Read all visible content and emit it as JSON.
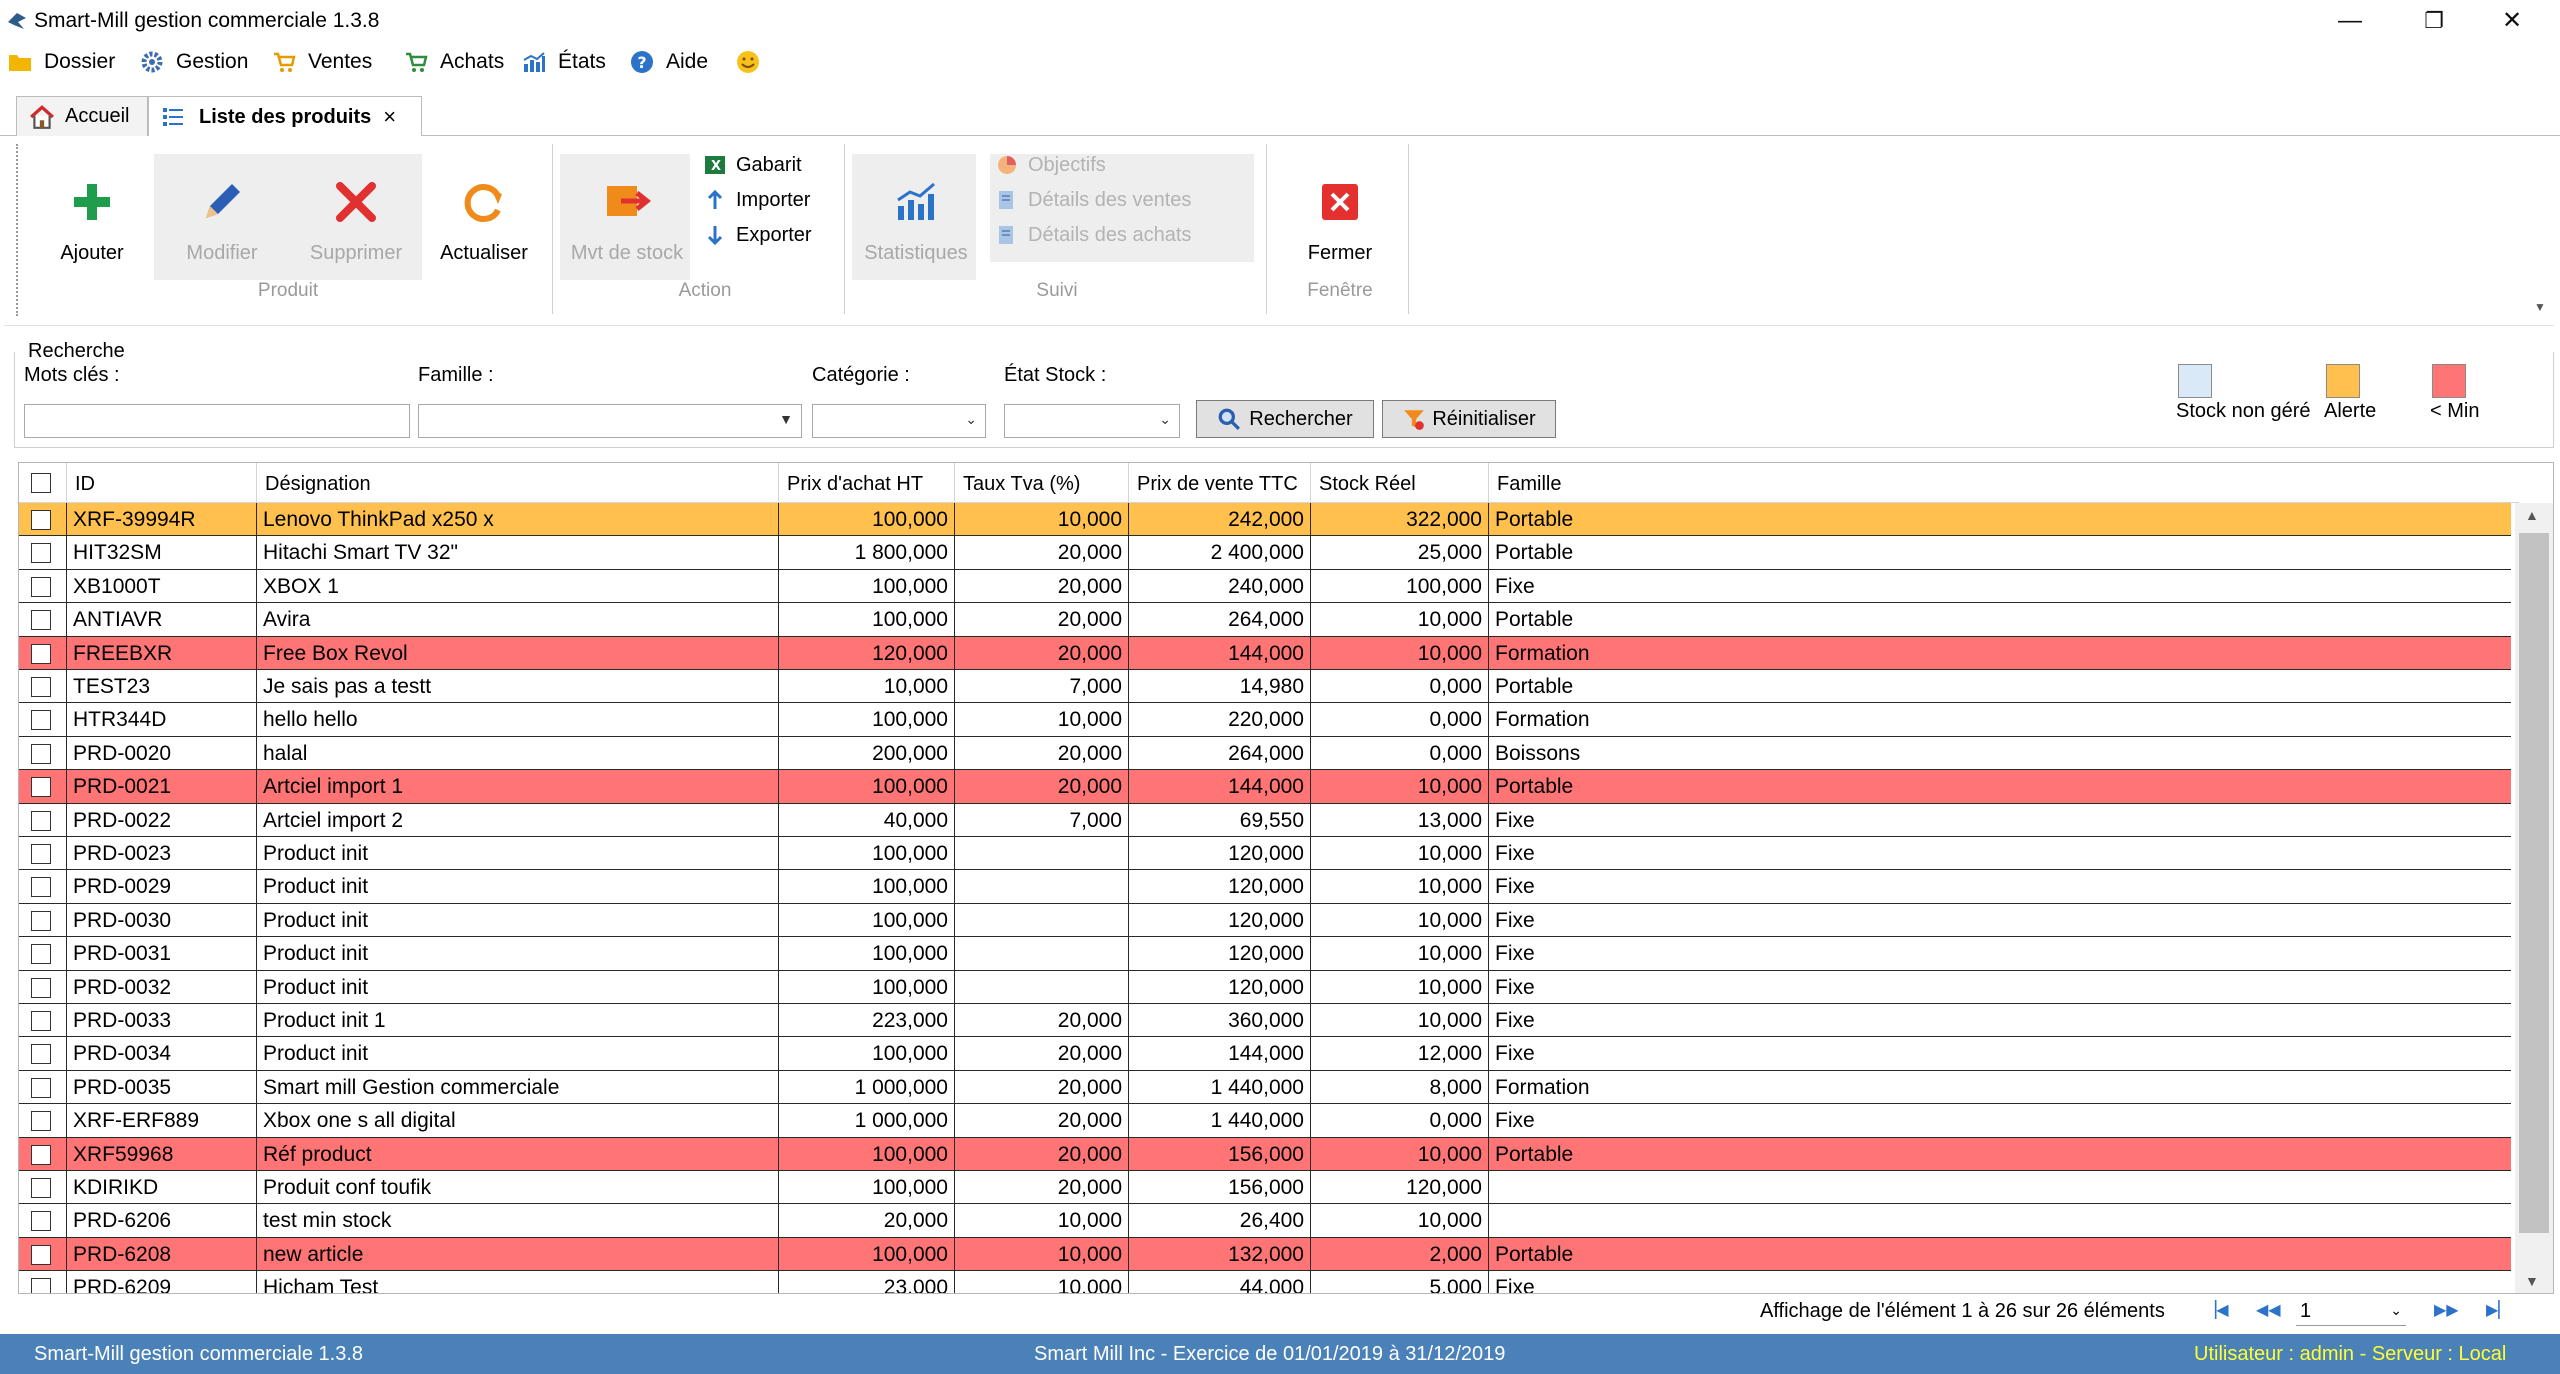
{
  "window": {
    "title": "Smart-Mill gestion commerciale 1.3.8",
    "minimize": "—",
    "restore": "❐",
    "close": "✕"
  },
  "menu": [
    {
      "label": "Dossier",
      "icon": "folder-icon",
      "color": "#f2b600"
    },
    {
      "label": "Gestion",
      "icon": "gear-icon",
      "color": "#3c6db1"
    },
    {
      "label": "Ventes",
      "icon": "cart-icon",
      "color": "#e39b00"
    },
    {
      "label": "Achats",
      "icon": "cart-icon",
      "color": "#2d8d3a"
    },
    {
      "label": "États",
      "icon": "bar-chart-icon",
      "color": "#2a73c9"
    },
    {
      "label": "Aide",
      "icon": "help-icon",
      "color": "#2a73c9"
    }
  ],
  "tabs": [
    {
      "label": "Accueil",
      "icon": "home-icon"
    },
    {
      "label": "Liste des produits",
      "icon": "list-icon",
      "close": "×"
    }
  ],
  "ribbon": {
    "produit": {
      "label": "Produit",
      "ajouter": "Ajouter",
      "modifier": "Modifier",
      "supprimer": "Supprimer",
      "actualiser": "Actualiser"
    },
    "action": {
      "label": "Action",
      "mvt_stock": "Mvt de stock",
      "gabarit": "Gabarit",
      "importer": "Importer",
      "exporter": "Exporter"
    },
    "suivi": {
      "label": "Suivi",
      "statistiques": "Statistiques",
      "objectifs": "Objectifs",
      "details_ventes": "Détails des ventes",
      "details_achats": "Détails des achats"
    },
    "fenetre": {
      "label": "Fenêtre",
      "fermer": "Fermer"
    }
  },
  "search": {
    "title": "Recherche",
    "keywords_label": "Mots clés :",
    "keywords_value": "",
    "famille_label": "Famille :",
    "categorie_label": "Catégorie :",
    "etat_stock_label": "État Stock :",
    "search_button": "Rechercher",
    "reset_button": "Réinitialiser"
  },
  "legend": [
    {
      "label": "Stock non géré",
      "color": "#d9e9f8"
    },
    {
      "label": "Alerte",
      "color": "#ffc04d"
    },
    {
      "label": "< Min",
      "color": "#ff7474"
    }
  ],
  "colors": {
    "alerte": "#ffc04d",
    "min": "#ff7474",
    "statusbar": "#4a81b8",
    "status_user": "#ffff33"
  },
  "table": {
    "columns": [
      "ID",
      "Désignation",
      "Prix d'achat HT",
      "Taux Tva (%)",
      "Prix de vente TTC",
      "Stock Réel",
      "Famille"
    ],
    "rows": [
      {
        "id": "XRF-39994R",
        "designation": "Lenovo ThinkPad x250 x",
        "prix_achat": "100,000",
        "tva": "10,000",
        "prix_vente": "242,000",
        "stock": "322,000",
        "famille": "Portable",
        "status": "alerte"
      },
      {
        "id": "HIT32SM",
        "designation": "Hitachi Smart TV 32\"",
        "prix_achat": "1 800,000",
        "tva": "20,000",
        "prix_vente": "2 400,000",
        "stock": "25,000",
        "famille": "Portable",
        "status": ""
      },
      {
        "id": "XB1000T",
        "designation": "XBOX 1",
        "prix_achat": "100,000",
        "tva": "20,000",
        "prix_vente": "240,000",
        "stock": "100,000",
        "famille": "Fixe",
        "status": ""
      },
      {
        "id": "ANTIAVR",
        "designation": "Avira",
        "prix_achat": "100,000",
        "tva": "20,000",
        "prix_vente": "264,000",
        "stock": "10,000",
        "famille": "Portable",
        "status": ""
      },
      {
        "id": "FREEBXR",
        "designation": "Free Box Revol",
        "prix_achat": "120,000",
        "tva": "20,000",
        "prix_vente": "144,000",
        "stock": "10,000",
        "famille": "Formation",
        "status": "min"
      },
      {
        "id": "TEST23",
        "designation": "Je sais pas a testt",
        "prix_achat": "10,000",
        "tva": "7,000",
        "prix_vente": "14,980",
        "stock": "0,000",
        "famille": "Portable",
        "status": ""
      },
      {
        "id": "HTR344D",
        "designation": "hello hello",
        "prix_achat": "100,000",
        "tva": "10,000",
        "prix_vente": "220,000",
        "stock": "0,000",
        "famille": "Formation",
        "status": ""
      },
      {
        "id": "PRD-0020",
        "designation": "halal",
        "prix_achat": "200,000",
        "tva": "20,000",
        "prix_vente": "264,000",
        "stock": "0,000",
        "famille": "Boissons",
        "status": ""
      },
      {
        "id": "PRD-0021",
        "designation": "Artciel import 1",
        "prix_achat": "100,000",
        "tva": "20,000",
        "prix_vente": "144,000",
        "stock": "10,000",
        "famille": "Portable",
        "status": "min"
      },
      {
        "id": "PRD-0022",
        "designation": "Artciel import 2",
        "prix_achat": "40,000",
        "tva": "7,000",
        "prix_vente": "69,550",
        "stock": "13,000",
        "famille": "Fixe",
        "status": ""
      },
      {
        "id": "PRD-0023",
        "designation": "Product init",
        "prix_achat": "100,000",
        "tva": "",
        "prix_vente": "120,000",
        "stock": "10,000",
        "famille": "Fixe",
        "status": ""
      },
      {
        "id": "PRD-0029",
        "designation": "Product init",
        "prix_achat": "100,000",
        "tva": "",
        "prix_vente": "120,000",
        "stock": "10,000",
        "famille": "Fixe",
        "status": ""
      },
      {
        "id": "PRD-0030",
        "designation": "Product init",
        "prix_achat": "100,000",
        "tva": "",
        "prix_vente": "120,000",
        "stock": "10,000",
        "famille": "Fixe",
        "status": ""
      },
      {
        "id": "PRD-0031",
        "designation": "Product init",
        "prix_achat": "100,000",
        "tva": "",
        "prix_vente": "120,000",
        "stock": "10,000",
        "famille": "Fixe",
        "status": ""
      },
      {
        "id": "PRD-0032",
        "designation": "Product init",
        "prix_achat": "100,000",
        "tva": "",
        "prix_vente": "120,000",
        "stock": "10,000",
        "famille": "Fixe",
        "status": ""
      },
      {
        "id": "PRD-0033",
        "designation": "Product init 1",
        "prix_achat": "223,000",
        "tva": "20,000",
        "prix_vente": "360,000",
        "stock": "10,000",
        "famille": "Fixe",
        "status": ""
      },
      {
        "id": "PRD-0034",
        "designation": "Product init",
        "prix_achat": "100,000",
        "tva": "20,000",
        "prix_vente": "144,000",
        "stock": "12,000",
        "famille": "Fixe",
        "status": ""
      },
      {
        "id": "PRD-0035",
        "designation": "Smart mill Gestion commerciale",
        "prix_achat": "1 000,000",
        "tva": "20,000",
        "prix_vente": "1 440,000",
        "stock": "8,000",
        "famille": "Formation",
        "status": ""
      },
      {
        "id": "XRF-ERF889",
        "designation": "Xbox one s all digital",
        "prix_achat": "1 000,000",
        "tva": "20,000",
        "prix_vente": "1 440,000",
        "stock": "0,000",
        "famille": "Fixe",
        "status": ""
      },
      {
        "id": "XRF59968",
        "designation": "Réf product",
        "prix_achat": "100,000",
        "tva": "20,000",
        "prix_vente": "156,000",
        "stock": "10,000",
        "famille": "Portable",
        "status": "min"
      },
      {
        "id": "KDIRIKD",
        "designation": "Produit conf toufik",
        "prix_achat": "100,000",
        "tva": "20,000",
        "prix_vente": "156,000",
        "stock": "120,000",
        "famille": "",
        "status": ""
      },
      {
        "id": "PRD-6206",
        "designation": "test min stock",
        "prix_achat": "20,000",
        "tva": "10,000",
        "prix_vente": "26,400",
        "stock": "10,000",
        "famille": "",
        "status": ""
      },
      {
        "id": "PRD-6208",
        "designation": "new article",
        "prix_achat": "100,000",
        "tva": "10,000",
        "prix_vente": "132,000",
        "stock": "2,000",
        "famille": "Portable",
        "status": "min"
      },
      {
        "id": "PRD-6209",
        "designation": "Hicham Test",
        "prix_achat": "23,000",
        "tva": "10,000",
        "prix_vente": "44,000",
        "stock": "5,000",
        "famille": "Fixe",
        "status": ""
      }
    ]
  },
  "pager": {
    "info": "Affichage de l'élément 1 à 26 sur 26 éléments",
    "page": "1"
  },
  "status": {
    "left": "Smart-Mill gestion commerciale 1.3.8",
    "center": "Smart Mill Inc - Exercice de 01/01/2019 à 31/12/2019",
    "right": "Utilisateur : admin - Serveur : Local"
  }
}
